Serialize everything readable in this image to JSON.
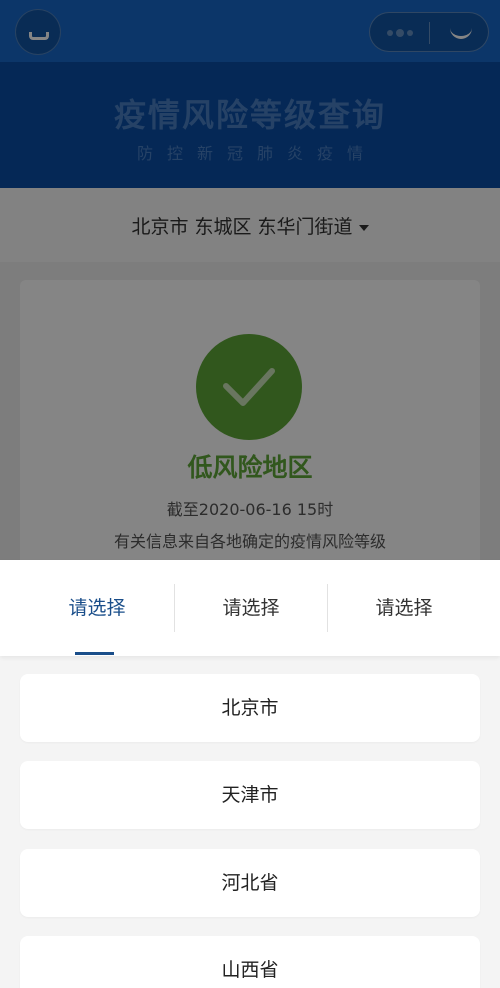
{
  "banner": {
    "title": "疫情风险等级查询",
    "subtitle": "防控新冠肺炎疫情"
  },
  "location": {
    "selected": "北京市 东城区 东华门街道"
  },
  "result": {
    "level": "低风险地区",
    "updated": "截至2020-06-16 15时",
    "note": "有关信息来自各地确定的疫情风险等级",
    "color": "#5fa838"
  },
  "picker": {
    "tabs": [
      {
        "label": "请选择",
        "active": true
      },
      {
        "label": "请选择",
        "active": false
      },
      {
        "label": "请选择",
        "active": false
      }
    ],
    "options": [
      {
        "label": "北京市"
      },
      {
        "label": "天津市"
      },
      {
        "label": "河北省"
      },
      {
        "label": "山西省"
      }
    ],
    "accent_color": "#1a4e8a"
  },
  "icons": {
    "back": "back-icon",
    "more": "more-icon",
    "close": "close-icon",
    "check": "check-icon",
    "caret": "caret-down-icon"
  },
  "colors": {
    "topbar": "#1768c9",
    "banner": "#0a4ea6"
  }
}
